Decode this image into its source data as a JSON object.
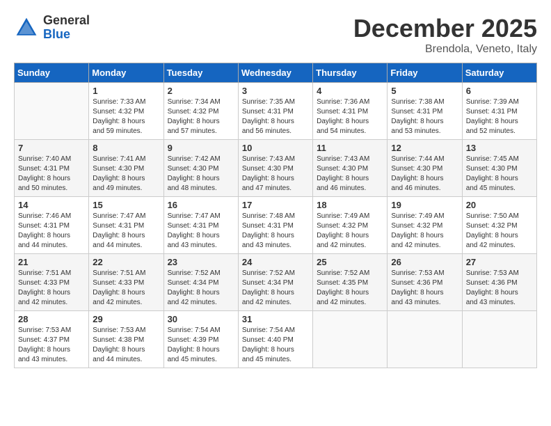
{
  "header": {
    "logo_line1": "General",
    "logo_line2": "Blue",
    "month": "December 2025",
    "location": "Brendola, Veneto, Italy"
  },
  "weekdays": [
    "Sunday",
    "Monday",
    "Tuesday",
    "Wednesday",
    "Thursday",
    "Friday",
    "Saturday"
  ],
  "weeks": [
    [
      {
        "day": "",
        "info": ""
      },
      {
        "day": "1",
        "info": "Sunrise: 7:33 AM\nSunset: 4:32 PM\nDaylight: 8 hours\nand 59 minutes."
      },
      {
        "day": "2",
        "info": "Sunrise: 7:34 AM\nSunset: 4:32 PM\nDaylight: 8 hours\nand 57 minutes."
      },
      {
        "day": "3",
        "info": "Sunrise: 7:35 AM\nSunset: 4:31 PM\nDaylight: 8 hours\nand 56 minutes."
      },
      {
        "day": "4",
        "info": "Sunrise: 7:36 AM\nSunset: 4:31 PM\nDaylight: 8 hours\nand 54 minutes."
      },
      {
        "day": "5",
        "info": "Sunrise: 7:38 AM\nSunset: 4:31 PM\nDaylight: 8 hours\nand 53 minutes."
      },
      {
        "day": "6",
        "info": "Sunrise: 7:39 AM\nSunset: 4:31 PM\nDaylight: 8 hours\nand 52 minutes."
      }
    ],
    [
      {
        "day": "7",
        "info": "Sunrise: 7:40 AM\nSunset: 4:31 PM\nDaylight: 8 hours\nand 50 minutes."
      },
      {
        "day": "8",
        "info": "Sunrise: 7:41 AM\nSunset: 4:30 PM\nDaylight: 8 hours\nand 49 minutes."
      },
      {
        "day": "9",
        "info": "Sunrise: 7:42 AM\nSunset: 4:30 PM\nDaylight: 8 hours\nand 48 minutes."
      },
      {
        "day": "10",
        "info": "Sunrise: 7:43 AM\nSunset: 4:30 PM\nDaylight: 8 hours\nand 47 minutes."
      },
      {
        "day": "11",
        "info": "Sunrise: 7:43 AM\nSunset: 4:30 PM\nDaylight: 8 hours\nand 46 minutes."
      },
      {
        "day": "12",
        "info": "Sunrise: 7:44 AM\nSunset: 4:30 PM\nDaylight: 8 hours\nand 46 minutes."
      },
      {
        "day": "13",
        "info": "Sunrise: 7:45 AM\nSunset: 4:30 PM\nDaylight: 8 hours\nand 45 minutes."
      }
    ],
    [
      {
        "day": "14",
        "info": "Sunrise: 7:46 AM\nSunset: 4:31 PM\nDaylight: 8 hours\nand 44 minutes."
      },
      {
        "day": "15",
        "info": "Sunrise: 7:47 AM\nSunset: 4:31 PM\nDaylight: 8 hours\nand 44 minutes."
      },
      {
        "day": "16",
        "info": "Sunrise: 7:47 AM\nSunset: 4:31 PM\nDaylight: 8 hours\nand 43 minutes."
      },
      {
        "day": "17",
        "info": "Sunrise: 7:48 AM\nSunset: 4:31 PM\nDaylight: 8 hours\nand 43 minutes."
      },
      {
        "day": "18",
        "info": "Sunrise: 7:49 AM\nSunset: 4:32 PM\nDaylight: 8 hours\nand 42 minutes."
      },
      {
        "day": "19",
        "info": "Sunrise: 7:49 AM\nSunset: 4:32 PM\nDaylight: 8 hours\nand 42 minutes."
      },
      {
        "day": "20",
        "info": "Sunrise: 7:50 AM\nSunset: 4:32 PM\nDaylight: 8 hours\nand 42 minutes."
      }
    ],
    [
      {
        "day": "21",
        "info": "Sunrise: 7:51 AM\nSunset: 4:33 PM\nDaylight: 8 hours\nand 42 minutes."
      },
      {
        "day": "22",
        "info": "Sunrise: 7:51 AM\nSunset: 4:33 PM\nDaylight: 8 hours\nand 42 minutes."
      },
      {
        "day": "23",
        "info": "Sunrise: 7:52 AM\nSunset: 4:34 PM\nDaylight: 8 hours\nand 42 minutes."
      },
      {
        "day": "24",
        "info": "Sunrise: 7:52 AM\nSunset: 4:34 PM\nDaylight: 8 hours\nand 42 minutes."
      },
      {
        "day": "25",
        "info": "Sunrise: 7:52 AM\nSunset: 4:35 PM\nDaylight: 8 hours\nand 42 minutes."
      },
      {
        "day": "26",
        "info": "Sunrise: 7:53 AM\nSunset: 4:36 PM\nDaylight: 8 hours\nand 43 minutes."
      },
      {
        "day": "27",
        "info": "Sunrise: 7:53 AM\nSunset: 4:36 PM\nDaylight: 8 hours\nand 43 minutes."
      }
    ],
    [
      {
        "day": "28",
        "info": "Sunrise: 7:53 AM\nSunset: 4:37 PM\nDaylight: 8 hours\nand 43 minutes."
      },
      {
        "day": "29",
        "info": "Sunrise: 7:53 AM\nSunset: 4:38 PM\nDaylight: 8 hours\nand 44 minutes."
      },
      {
        "day": "30",
        "info": "Sunrise: 7:54 AM\nSunset: 4:39 PM\nDaylight: 8 hours\nand 45 minutes."
      },
      {
        "day": "31",
        "info": "Sunrise: 7:54 AM\nSunset: 4:40 PM\nDaylight: 8 hours\nand 45 minutes."
      },
      {
        "day": "",
        "info": ""
      },
      {
        "day": "",
        "info": ""
      },
      {
        "day": "",
        "info": ""
      }
    ]
  ]
}
